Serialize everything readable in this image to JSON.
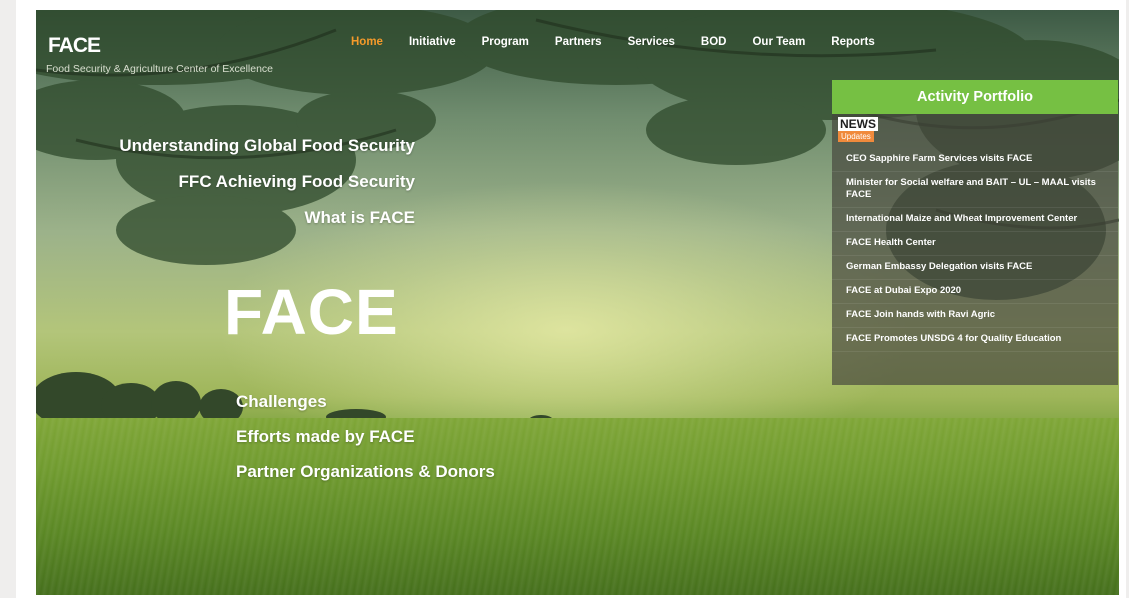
{
  "header": {
    "logo": "FACE",
    "tagline": "Food Security & Agriculture Center of Excellence",
    "nav": [
      "Home",
      "Initiative",
      "Program",
      "Partners",
      "Services",
      "BOD",
      "Our Team",
      "Reports"
    ],
    "active_nav": "Home"
  },
  "left_links": {
    "top": [
      "Understanding Global Food Security",
      "FFC Achieving Food Security",
      "What is FACE"
    ],
    "big_title": "FACE",
    "bottom": [
      "Challenges",
      "Efforts made by FACE",
      "Partner Organizations & Donors"
    ]
  },
  "portfolio": {
    "title": "Activity Portfolio",
    "news_label": "NEWS",
    "updates_label": "Updates",
    "items": [
      "CEO Sapphire Farm Services visits FACE",
      "Minister for Social welfare and BAIT – UL – MAAL visits FACE",
      "International Maize and Wheat Improvement Center",
      "FACE Health Center",
      "German Embassy Delegation visits FACE",
      "FACE at Dubai Expo 2020",
      "FACE Join hands with Ravi Agric",
      "FACE Promotes UNSDG 4 for Quality Education"
    ]
  },
  "colors": {
    "accent_green": "#76c043",
    "nav_active": "#f59a2a",
    "updates_badge": "#f08a3c"
  }
}
